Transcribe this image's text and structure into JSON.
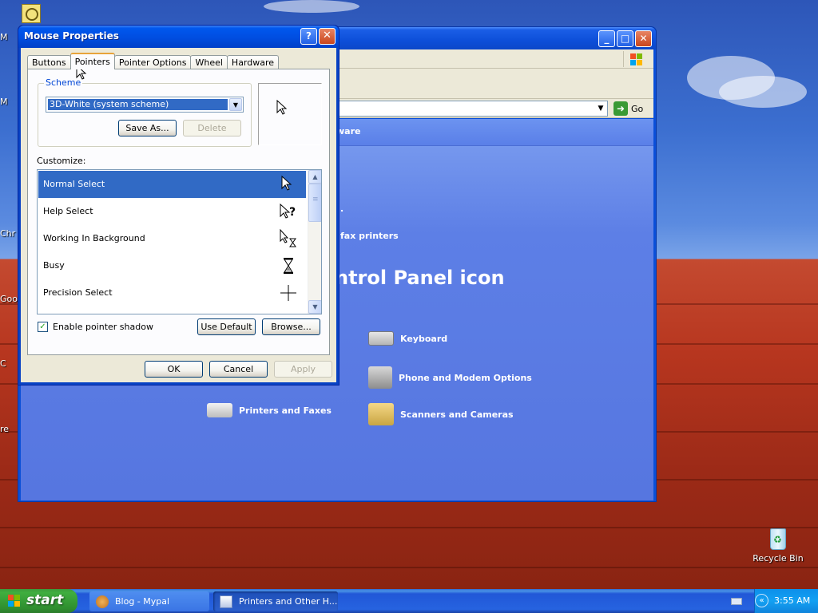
{
  "desktop": {
    "left_stubs": [
      "M",
      "M",
      "Chr",
      "Goo",
      "C",
      "re"
    ],
    "recycle_bin_label": "Recycle Bin"
  },
  "control_panel": {
    "go_label": "Go",
    "banner_text": "ware",
    "dot_text": ".",
    "fax_printers_text": "fax printers",
    "heading": "ntrol Panel icon",
    "items": {
      "keyboard": "Keyboard",
      "phone_modem": "Phone and Modem Options",
      "printers_faxes": "Printers and Faxes",
      "scanners_cameras": "Scanners and Cameras"
    }
  },
  "dialog": {
    "title": "Mouse Properties",
    "help_glyph": "?",
    "close_glyph": "✕",
    "tabs": [
      "Buttons",
      "Pointers",
      "Pointer Options",
      "Wheel",
      "Hardware"
    ],
    "active_tab": "Pointers",
    "scheme": {
      "legend": "Scheme",
      "selected": "3D-White (system scheme)",
      "save_as_label": "Save As...",
      "delete_label": "Delete"
    },
    "customize_label": "Customize:",
    "pointers": [
      {
        "name": "Normal Select",
        "icon": "arrow-cursor-icon"
      },
      {
        "name": "Help Select",
        "icon": "help-cursor-icon"
      },
      {
        "name": "Working In Background",
        "icon": "working-cursor-icon"
      },
      {
        "name": "Busy",
        "icon": "hourglass-icon"
      },
      {
        "name": "Precision Select",
        "icon": "crosshair-icon"
      }
    ],
    "selected_pointer": "Normal Select",
    "enable_shadow_label": "Enable pointer shadow",
    "enable_shadow_checked": true,
    "use_default_label": "Use Default",
    "browse_label": "Browse...",
    "ok_label": "OK",
    "cancel_label": "Cancel",
    "apply_label": "Apply"
  },
  "taskbar": {
    "start_label": "start",
    "tasks": [
      {
        "label": "Blog - Mypal",
        "active": false
      },
      {
        "label": "Printers and Other H...",
        "active": true
      }
    ],
    "clock": "3:55 AM"
  },
  "colors": {
    "selection": "#316ac5",
    "dialog_face": "#ece9d8",
    "xp_title_blue": "#0058ee",
    "start_green": "#3fae3f"
  }
}
